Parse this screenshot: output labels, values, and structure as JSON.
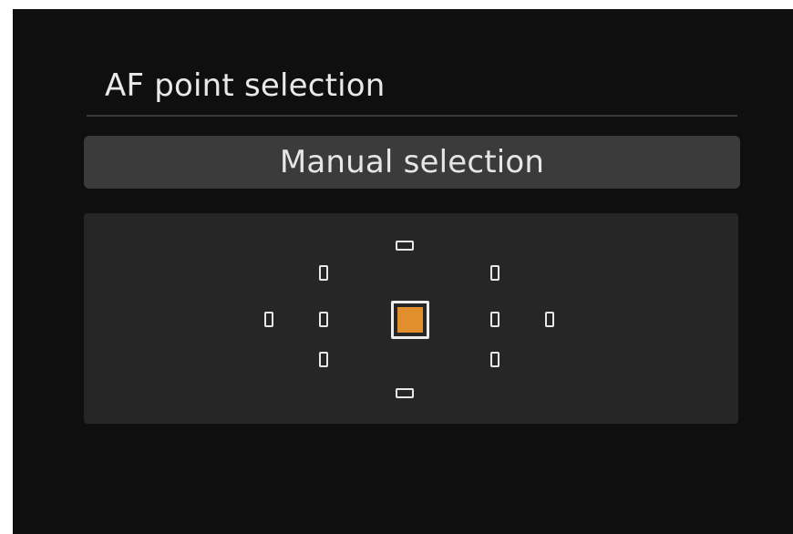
{
  "screen": {
    "title": "AF point selection",
    "mode": "Manual selection"
  },
  "af_points": {
    "selected": "center",
    "accent_color": "#e08f2c"
  }
}
